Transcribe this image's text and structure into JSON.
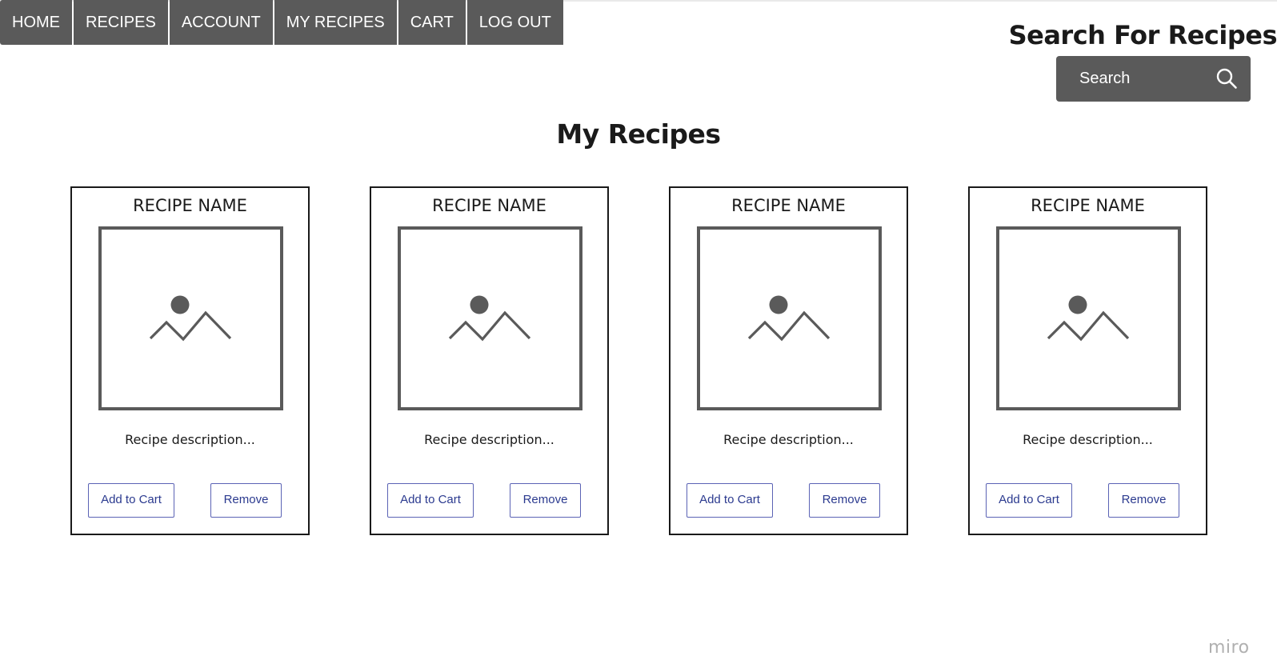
{
  "nav": {
    "items": [
      {
        "label": "HOME"
      },
      {
        "label": "RECIPES"
      },
      {
        "label": "ACCOUNT"
      },
      {
        "label": "MY RECIPES"
      },
      {
        "label": "CART"
      },
      {
        "label": "LOG OUT"
      }
    ]
  },
  "search": {
    "heading": "Search For Recipes",
    "placeholder": "Search",
    "icon": "search-icon"
  },
  "page": {
    "title": "My Recipes"
  },
  "cards": [
    {
      "name": "RECIPE NAME",
      "image_icon": "image-placeholder-icon",
      "description": "Recipe description...",
      "add_label": "Add to Cart",
      "remove_label": "Remove"
    },
    {
      "name": "RECIPE NAME",
      "image_icon": "image-placeholder-icon",
      "description": "Recipe description...",
      "add_label": "Add to Cart",
      "remove_label": "Remove"
    },
    {
      "name": "RECIPE NAME",
      "image_icon": "image-placeholder-icon",
      "description": "Recipe description...",
      "add_label": "Add to Cart",
      "remove_label": "Remove"
    },
    {
      "name": "RECIPE NAME",
      "image_icon": "image-placeholder-icon",
      "description": "Recipe description...",
      "add_label": "Add to Cart",
      "remove_label": "Remove"
    }
  ],
  "watermark": "miro",
  "colors": {
    "nav_bg": "#5a5a5a",
    "button_border": "#5b63b5",
    "button_text": "#2b3a8f",
    "image_stroke": "#5a5a5a"
  }
}
